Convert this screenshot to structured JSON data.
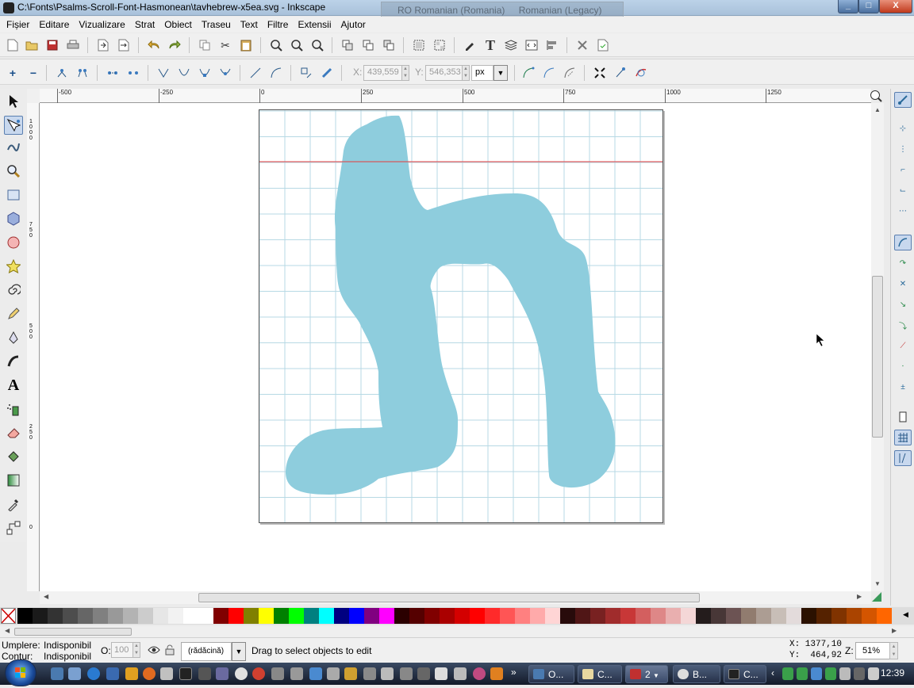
{
  "window": {
    "title": "C:\\Fonts\\Psalms-Scroll-Font-Hasmonean\\tavhebrew-x5ea.svg - Inkscape",
    "language_bar": [
      "RO Romanian (Romania)",
      "Romanian (Legacy)"
    ],
    "minimize": "_",
    "maximize": "□",
    "close": "X"
  },
  "menu": [
    "Fișier",
    "Editare",
    "Vizualizare",
    "Strat",
    "Obiect",
    "Traseu",
    "Text",
    "Filtre",
    "Extensii",
    "Ajutor"
  ],
  "node_toolbar": {
    "x_label": "X:",
    "x_value": "439,559",
    "y_label": "Y:",
    "y_value": "546,353",
    "unit": "px"
  },
  "rulers": {
    "horizontal": [
      "-500",
      "-250",
      "0",
      "250",
      "500",
      "750",
      "1000",
      "1250"
    ],
    "vertical": [
      "1000",
      "750",
      "500",
      "250",
      "0"
    ]
  },
  "status": {
    "fill_label": "Umplere:",
    "fill_value": "Indisponibil",
    "stroke_label": "Contur:",
    "stroke_value": "Indisponibil",
    "opacity_label": "O:",
    "opacity_value": "100",
    "layer": "(rădăcină)",
    "message": "Drag to select objects to edit",
    "x_readout": "X: 1377,10",
    "y_readout": "Y:  464,92",
    "zoom_label": "Z:",
    "zoom_value": "51%"
  },
  "taskbar": {
    "buttons": [
      "O...",
      "C...",
      "2",
      "B...",
      "C..."
    ],
    "clock": "12:39"
  },
  "colors": {
    "shape_fill": "#8ecddd",
    "grid": "#b7d9e4",
    "guide": "#e53c3c",
    "accent": "#2a6a9a"
  },
  "palette": [
    "#000000",
    "#1a1a1a",
    "#333333",
    "#4d4d4d",
    "#666666",
    "#808080",
    "#999999",
    "#b3b3b3",
    "#cccccc",
    "#e6e6e6",
    "#f2f2f2",
    "#ffffff",
    "#ffffff",
    "#800000",
    "#ff0000",
    "#808000",
    "#ffff00",
    "#008000",
    "#00ff00",
    "#008080",
    "#00ffff",
    "#000080",
    "#0000ff",
    "#800080",
    "#ff00ff",
    "#2b0000",
    "#550000",
    "#800000",
    "#aa0000",
    "#d40000",
    "#ff0000",
    "#ff2a2a",
    "#ff5555",
    "#ff8080",
    "#ffaaaa",
    "#ffd5d5",
    "#280b0b",
    "#501616",
    "#782121",
    "#a02c2c",
    "#c83737",
    "#d35f5f",
    "#de8787",
    "#e9afaf",
    "#f4d7d7",
    "#241c1c",
    "#483737",
    "#6c5353",
    "#917c6f",
    "#ac9d93",
    "#c8beb7",
    "#e3dbdb",
    "#2b1100",
    "#552200",
    "#803300",
    "#aa4400",
    "#d45500",
    "#ff6600"
  ]
}
